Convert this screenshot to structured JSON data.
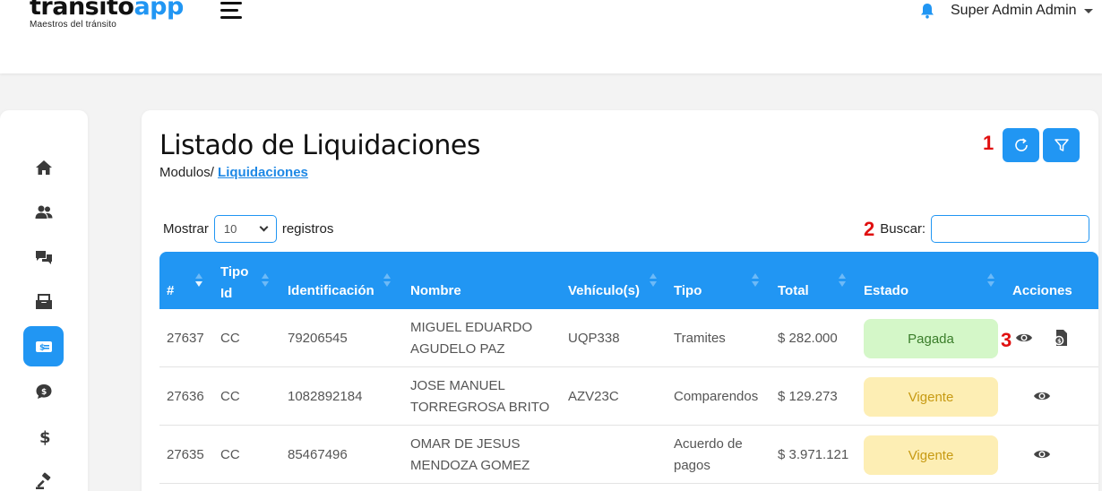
{
  "app": {
    "logo_part1": "transito",
    "logo_part2": "app",
    "logo_subtitle": "Maestros del tránsito",
    "user_name": "Super Admin Admin",
    "colors": {
      "accent": "#2196f3",
      "paid_bg": "#d4f7c8",
      "valid_bg": "#fdeeb4",
      "marker": "#e01010"
    }
  },
  "sidebar": {
    "items": [
      {
        "icon": "home-icon",
        "active": false
      },
      {
        "icon": "users-icon",
        "active": false
      },
      {
        "icon": "chat-icon",
        "active": false
      },
      {
        "icon": "inbox-icon",
        "active": false
      },
      {
        "icon": "billing-icon",
        "active": true
      },
      {
        "icon": "comment-dollar-icon",
        "active": false
      },
      {
        "icon": "dollar-icon",
        "active": false
      },
      {
        "icon": "gavel-icon",
        "active": false
      }
    ]
  },
  "page": {
    "title": "Listado de Liquidaciones",
    "breadcrumb_prefix": "Modulos/ ",
    "breadcrumb_current": "Liquidaciones",
    "markers": [
      "1",
      "2",
      "3"
    ]
  },
  "controls": {
    "show_label": "Mostrar",
    "show_value": "10",
    "records_label": "registros",
    "search_label": "Buscar:",
    "search_value": ""
  },
  "table": {
    "headers": [
      "#",
      "Tipo Id",
      "Identificación",
      "Nombre",
      "Vehículo(s)",
      "Tipo",
      "Total",
      "Estado",
      "Acciones"
    ],
    "rows": [
      {
        "id": "27637",
        "tipo_id": "CC",
        "identificacion": "79206545",
        "nombre_1": "MIGUEL EDUARDO",
        "nombre_2": "AGUDELO PAZ",
        "vehiculo": "UQP338",
        "tipo_1": "Tramites",
        "tipo_2": "",
        "total": "$ 282.000",
        "estado": "Pagada"
      },
      {
        "id": "27636",
        "tipo_id": "CC",
        "identificacion": "1082892184",
        "nombre_1": "JOSE MANUEL",
        "nombre_2": "TORREGROSA BRITO",
        "vehiculo": "AZV23C",
        "tipo_1": "Comparendos",
        "tipo_2": "",
        "total": "$ 129.273",
        "estado": "Vigente"
      },
      {
        "id": "27635",
        "tipo_id": "CC",
        "identificacion": "85467496",
        "nombre_1": "OMAR DE JESUS",
        "nombre_2": "MENDOZA GOMEZ",
        "vehiculo": "",
        "tipo_1": "Acuerdo de",
        "tipo_2": "pagos",
        "total": "$ 3.971.121",
        "estado": "Vigente"
      }
    ]
  }
}
